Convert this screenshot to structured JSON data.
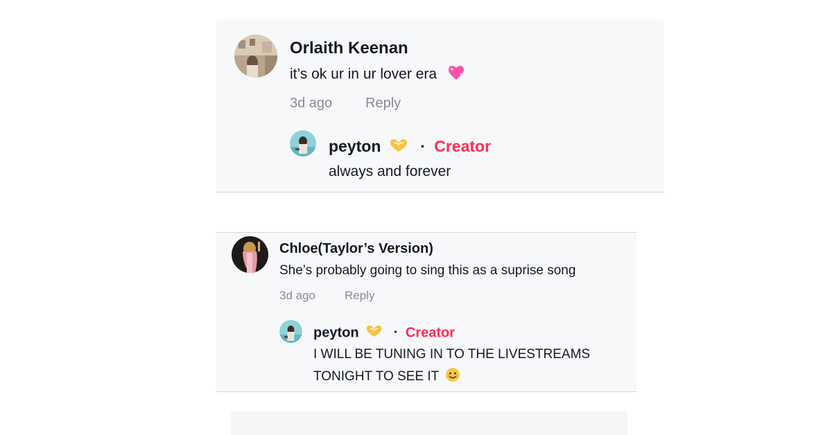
{
  "comments": [
    {
      "author": "Orlaith Keenan",
      "text": "it’s ok ur in ur lover era",
      "time": "3d ago",
      "reply_label": "Reply",
      "icons": {
        "emoji": "pink-heart-icon"
      },
      "reply": {
        "author": "peyton",
        "badge": "Creator",
        "separator": "·",
        "text": "always and forever",
        "icons": {
          "emoji": "heart-hands-icon"
        }
      }
    },
    {
      "author": "Chloe(Taylor’s  Version)",
      "text": "She’s probably going to sing this as a suprise song",
      "time": "3d ago",
      "reply_label": "Reply",
      "reply": {
        "author": "peyton",
        "badge": "Creator",
        "separator": "·",
        "text_line1": "I WILL BE TUNING IN TO THE LIVESTREAMS",
        "text_line2": "TONIGHT TO SEE IT",
        "icons": {
          "emoji": "heart-hands-icon",
          "text_emoji": "smiling-face-icon"
        }
      }
    }
  ],
  "colors": {
    "creator": "#fe2c55",
    "meta": "#8a8b91",
    "card_bg": "#f7f8fa",
    "text": "#161823"
  }
}
